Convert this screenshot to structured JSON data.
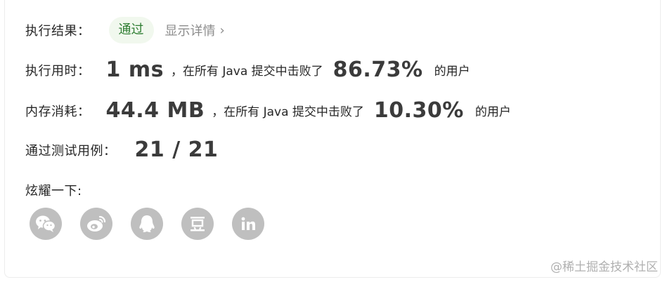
{
  "result": {
    "label": "执行结果：",
    "status": "通过",
    "details_link": "显示详情",
    "chevron": "›"
  },
  "runtime": {
    "label": "执行用时：",
    "value": "1 ms",
    "beat_text": "，在所有 Java 提交中击败了",
    "percent": "86.73%",
    "suffix": "的用户"
  },
  "memory": {
    "label": "内存消耗：",
    "value": "44.4 MB",
    "beat_text": "，在所有 Java 提交中击败了",
    "percent": "10.30%",
    "suffix": "的用户"
  },
  "tests": {
    "label": "通过测试用例：",
    "value": "21 / 21"
  },
  "share": {
    "label": "炫耀一下:",
    "icons": [
      "wechat-icon",
      "weibo-icon",
      "qq-icon",
      "douban-icon",
      "linkedin-icon"
    ]
  },
  "watermark": "@稀土掘金技术社区",
  "colors": {
    "pass_text": "#2e7d32",
    "pass_bg": "#f1f8ee",
    "icon_bg": "#bfbfbf"
  }
}
